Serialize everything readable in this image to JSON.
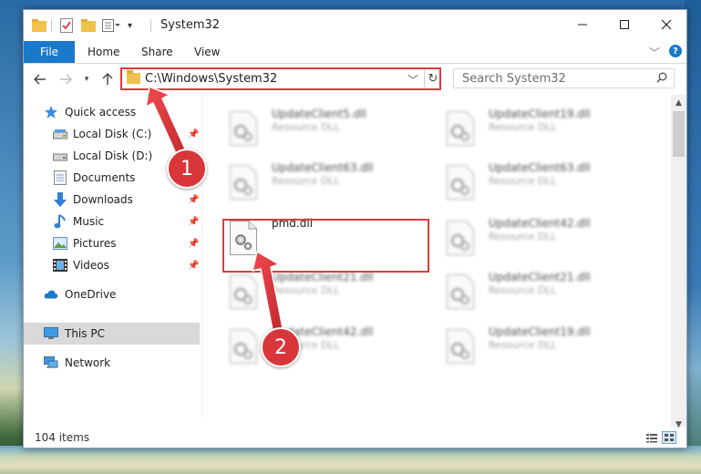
{
  "window": {
    "title": "System32"
  },
  "ribbon": {
    "file": "File",
    "home": "Home",
    "share": "Share",
    "view": "View",
    "help": "?"
  },
  "address": {
    "path": "C:\\Windows\\System32"
  },
  "search": {
    "placeholder": "Search System32"
  },
  "sidebar": {
    "quick_access": "Quick access",
    "items": [
      {
        "label": "Local Disk (C:)",
        "pinned": true
      },
      {
        "label": "Local Disk (D:)",
        "pinned": true
      },
      {
        "label": "Documents",
        "pinned": false
      },
      {
        "label": "Downloads",
        "pinned": true
      },
      {
        "label": "Music",
        "pinned": true
      },
      {
        "label": "Pictures",
        "pinned": true
      },
      {
        "label": "Videos",
        "pinned": true
      }
    ],
    "onedrive": "OneDrive",
    "this_pc": "This PC",
    "network": "Network"
  },
  "files": [
    {
      "name": "UpdateClient5.dll",
      "type": "Resource DLL",
      "blurred": true
    },
    {
      "name": "UpdateClient19.dll",
      "type": "Resource DLL",
      "blurred": true
    },
    {
      "name": "UpdateClient63.dll",
      "type": "Resource DLL",
      "blurred": true
    },
    {
      "name": "UpdateClient63.dll",
      "type": "Resource DLL",
      "blurred": true
    },
    {
      "name": "pmd.dll",
      "type": "",
      "blurred": false
    },
    {
      "name": "UpdateClient42.dll",
      "type": "Resource DLL",
      "blurred": true
    },
    {
      "name": "UpdateClient21.dll",
      "type": "Resource DLL",
      "blurred": true
    },
    {
      "name": "UpdateClient21.dll",
      "type": "Resource DLL",
      "blurred": true
    },
    {
      "name": "UpdateClient42.dll",
      "type": "Resource DLL",
      "blurred": true
    },
    {
      "name": "UpdateClient19.dll",
      "type": "Resource DLL",
      "blurred": true
    }
  ],
  "status": {
    "count": "104 items"
  },
  "annotations": {
    "step1": "1",
    "step2": "2"
  },
  "colors": {
    "accent": "#1979ca",
    "highlight": "#e0393e",
    "selected_nav": "#d9d9d9"
  }
}
